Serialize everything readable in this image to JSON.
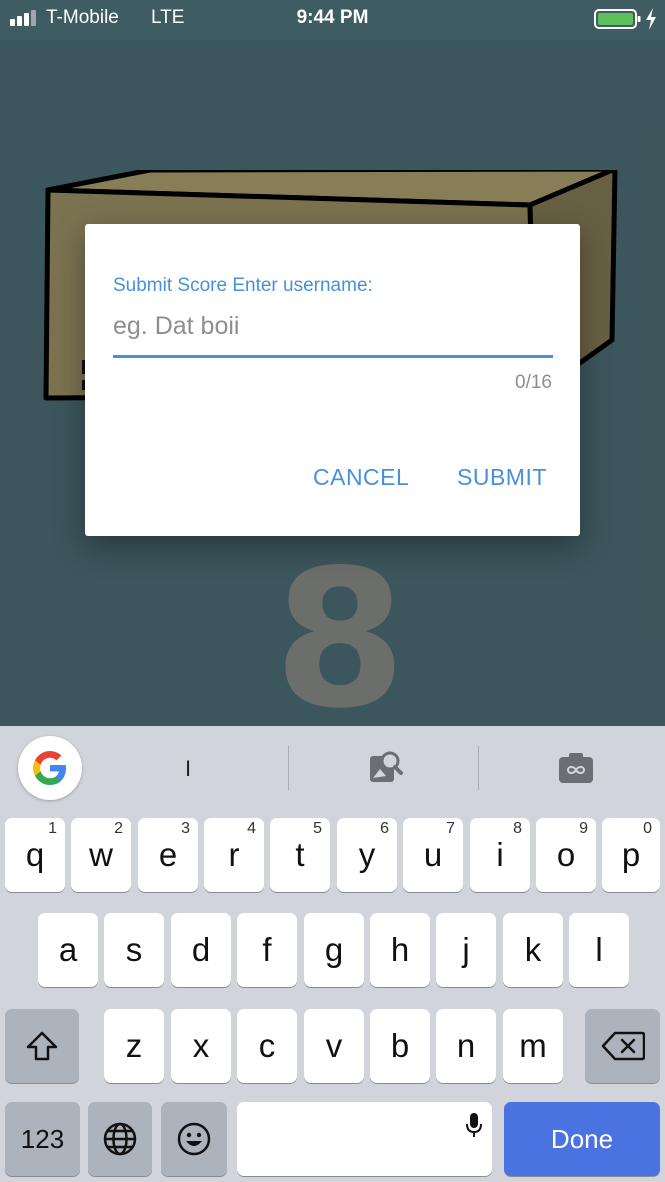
{
  "status_bar": {
    "carrier": "T-Mobile",
    "network": "LTE",
    "time": "9:44 PM",
    "signal_icon": "signal-bars-icon",
    "battery_icon": "battery-icon",
    "charging_icon": "charging-bolt-icon",
    "battery_color": "#5ec05a"
  },
  "game": {
    "score": "8",
    "background_color": "#3f5c62",
    "box_color": "#837a56"
  },
  "dialog": {
    "label": "Submit Score Enter username:",
    "placeholder": "eg. Dat boii",
    "value": "",
    "counter": "0/16",
    "cancel_label": "CANCEL",
    "submit_label": "SUBMIT",
    "accent_color": "#4a90d9"
  },
  "keyboard": {
    "suggestion": "I",
    "google_icon": "google-logo-icon",
    "image_search_icon": "image-search-icon",
    "gif_icon": "gif-camera-icon",
    "row1": [
      {
        "key": "q",
        "hint": "1"
      },
      {
        "key": "w",
        "hint": "2"
      },
      {
        "key": "e",
        "hint": "3"
      },
      {
        "key": "r",
        "hint": "4"
      },
      {
        "key": "t",
        "hint": "5"
      },
      {
        "key": "y",
        "hint": "6"
      },
      {
        "key": "u",
        "hint": "7"
      },
      {
        "key": "i",
        "hint": "8"
      },
      {
        "key": "o",
        "hint": "9"
      },
      {
        "key": "p",
        "hint": "0"
      }
    ],
    "row2": [
      "a",
      "s",
      "d",
      "f",
      "g",
      "h",
      "j",
      "k",
      "l"
    ],
    "row3": [
      "z",
      "x",
      "c",
      "v",
      "b",
      "n",
      "m"
    ],
    "numbers_label": "123",
    "done_label": "Done",
    "shift_icon": "shift-arrow-icon",
    "backspace_icon": "backspace-icon",
    "globe_icon": "globe-icon",
    "emoji_icon": "emoji-icon",
    "mic_icon": "microphone-icon",
    "done_color": "#4a72e0"
  }
}
